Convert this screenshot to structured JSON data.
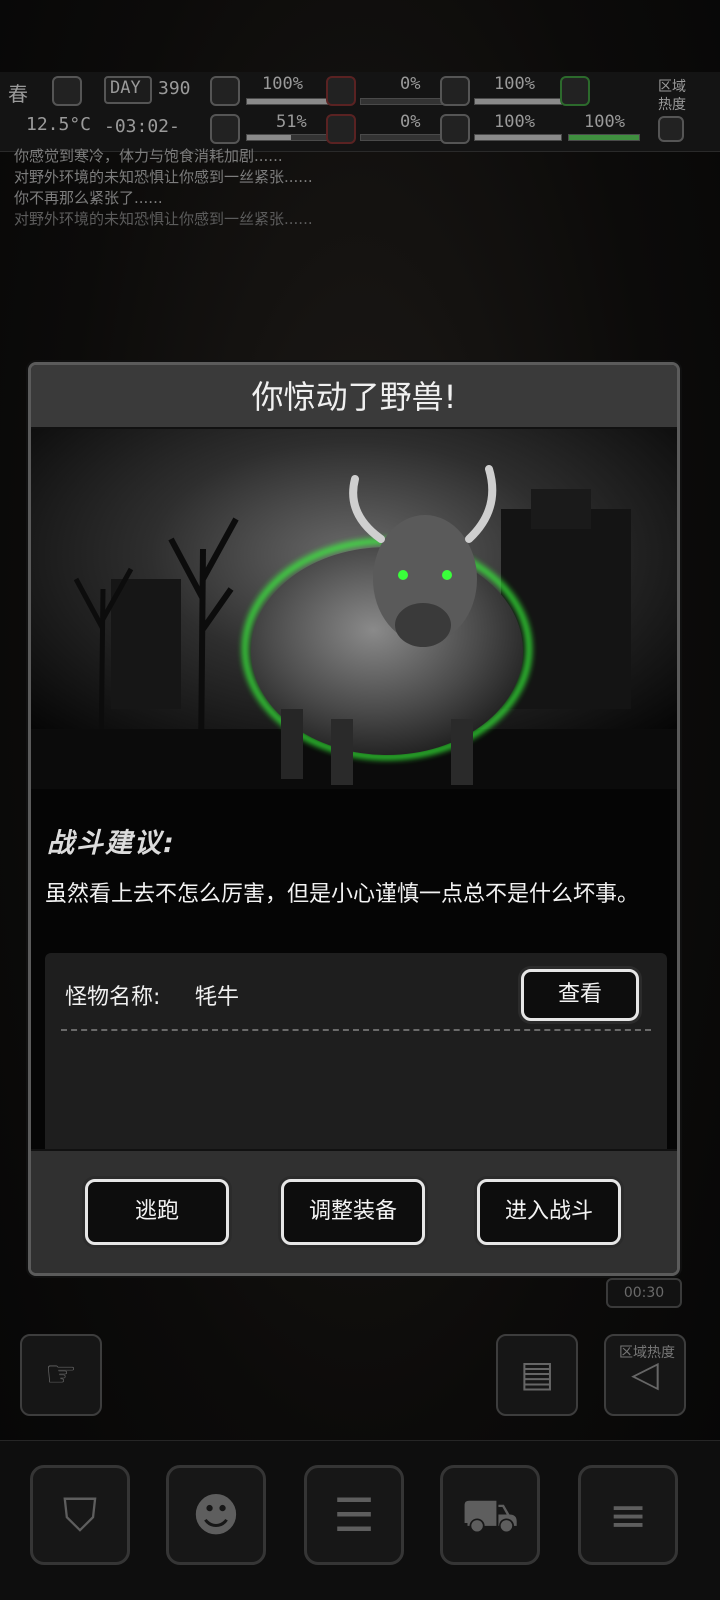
{
  "hud": {
    "season": "春",
    "temperature": "12.5°C",
    "day_label": "DAY",
    "day_number": "390",
    "clock": "-03:02-",
    "stats_row1": [
      "100%",
      "0%",
      "100%"
    ],
    "stats_row2": [
      "51%",
      "0%",
      "100%",
      "100%"
    ],
    "side_label": "区域热度",
    "fill_levels_row1": [
      1.0,
      0.0,
      1.0
    ],
    "fill_levels_row2": [
      0.51,
      0.0,
      1.0,
      1.0
    ]
  },
  "log": {
    "lines": [
      "你感觉到寒冷，体力与饱食消耗加剧......",
      "对野外环境的未知恐惧让你感到一丝紧张......",
      "你不再那么紧张了......",
      "对野外环境的未知恐惧让你感到一丝紧张......"
    ]
  },
  "modal": {
    "title": "你惊动了野兽!",
    "advice_title": "战斗建议:",
    "advice_text": "虽然看上去不怎么厉害，但是小心谨慎一点总不是什么坏事。",
    "monster_label": "怪物名称:",
    "monster_name": "牦牛",
    "view_button": "查看",
    "buttons": {
      "flee": "逃跑",
      "equip": "调整装备",
      "fight": "进入战斗"
    }
  },
  "side": {
    "heat_label": "区域热度",
    "timer": "00:30"
  },
  "icons": {
    "tabs": [
      "backpack-icon",
      "brain-icon",
      "notebook-icon",
      "cart-icon",
      "menu-icon"
    ],
    "accent_glow": "#39ff3a"
  }
}
